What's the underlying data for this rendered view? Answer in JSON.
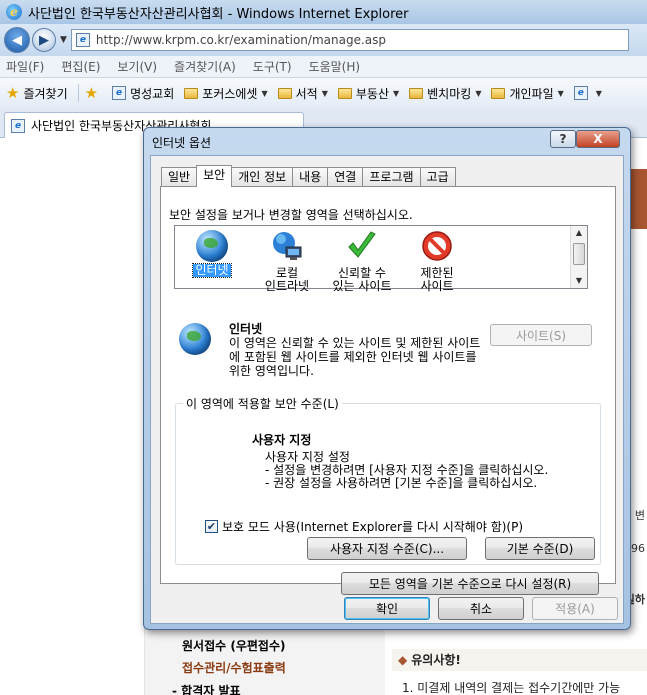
{
  "browser": {
    "window_title": "사단법인 한국부동산자산관리사협회 - Windows Internet Explorer",
    "url": "http://www.krpm.co.kr/examination/manage.asp",
    "menu": [
      "파일(F)",
      "편집(E)",
      "보기(V)",
      "즐겨찾기(A)",
      "도구(T)",
      "도움말(H)"
    ],
    "favorites_label": "즐겨찾기",
    "favorites": [
      "명성교회",
      "포커스에셋",
      "서적",
      "부동산",
      "벤치마킹",
      "개인파일"
    ],
    "tab_title": "사단법인 한국부동산자산관리사협회"
  },
  "page": {
    "side_menu": [
      "원서접수 (우편접수)",
      "접수관리/수험표출력",
      "- 합격자 발표"
    ],
    "notice_title": "유의사항!",
    "notice_line": "1. 미결제 내역의 결제는 접수기간에만 가능",
    "side_snippets": [
      "변",
      "196",
      "일하"
    ]
  },
  "dialog": {
    "title": "인터넷 옵션",
    "help_label": "?",
    "close_label": "X",
    "tabs": [
      "일반",
      "보안",
      "개인 정보",
      "내용",
      "연결",
      "프로그램",
      "고급"
    ],
    "zone_prompt": "보안 설정을 보거나 변경할 영역을 선택하십시오.",
    "zones": [
      {
        "line1": "인터넷",
        "line2": ""
      },
      {
        "line1": "로컬",
        "line2": "인트라넷"
      },
      {
        "line1": "신뢰할 수",
        "line2": "있는 사이트"
      },
      {
        "line1": "제한된",
        "line2": "사이트"
      }
    ],
    "zone_name": "인터넷",
    "zone_description": "이 영역은 신뢰할 수 있는 사이트 및 제한된 사이트에 포함된 웹 사이트를 제외한 인터넷 웹 사이트를 위한 영역입니다.",
    "sites_button": "사이트(S)",
    "level_legend": "이 영역에 적용할 보안 수준(L)",
    "level_title": "사용자 지정",
    "level_details": [
      "사용자 지정 설정",
      "- 설정을 변경하려면 [사용자 지정 수준]을 클릭하십시오.",
      "- 권장 설정을 사용하려면 [기본 수준]을 클릭하십시오."
    ],
    "protected_mode_checked": "✔",
    "protected_mode_label": "보호 모드 사용(Internet Explorer를 다시 시작해야 함)(P)",
    "custom_level_button": "사용자 지정 수준(C)...",
    "default_level_button": "기본 수준(D)",
    "reset_all_button": "모든 영역을 기본 수준으로 다시 설정(R)",
    "ok_button": "확인",
    "cancel_button": "취소",
    "apply_button": "적용(A)"
  },
  "colors": {
    "selection": "#3399ff",
    "brand_strip": "#a85531",
    "close_button": "#c44125"
  }
}
